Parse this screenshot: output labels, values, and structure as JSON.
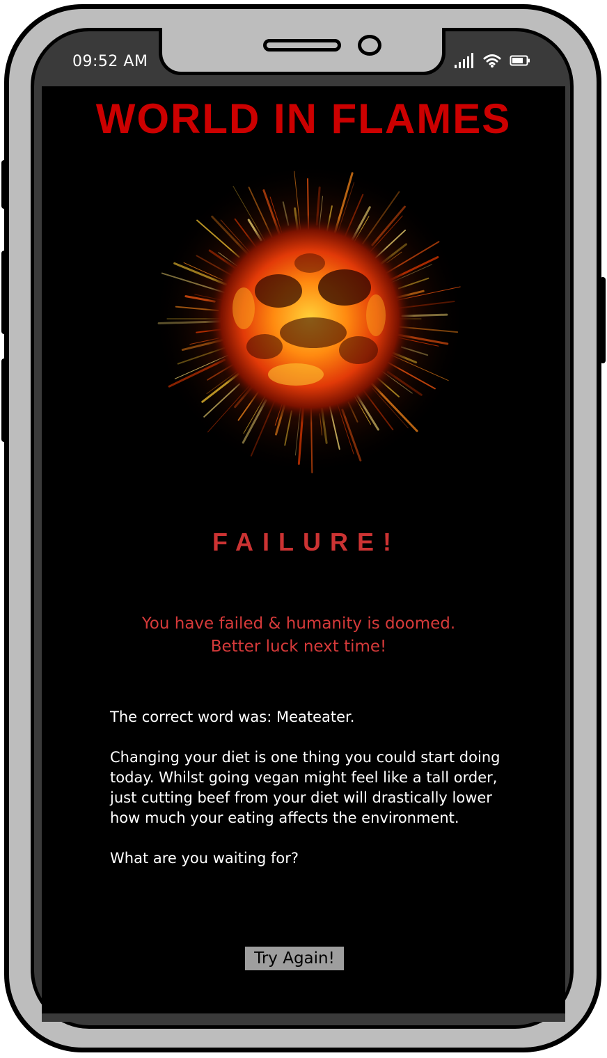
{
  "status_bar": {
    "time": "09:52 AM"
  },
  "app": {
    "title": "WORLD IN FLAMES",
    "result_heading": "FAILURE!",
    "doom_line1": "You have failed & humanity is doomed.",
    "doom_line2": "Better luck next time!",
    "correct_word_text": "The correct word was: Meateater.",
    "advice_text": "Changing your diet is one thing you could start doing today. Whilst going vegan might feel like a tall order, just cutting  beef from your diet will drastically lower how much your eating affects the environment.",
    "question_text": "What are you waiting for?",
    "try_again_label": "Try Again!"
  },
  "icons": {
    "explosion": "explosion-icon",
    "signal": "signal-icon",
    "wifi": "wifi-icon",
    "battery": "battery-icon"
  },
  "colors": {
    "title": "#cc0000",
    "failure": "#cc3333",
    "doom_text": "#d63a3a",
    "screen_bg": "#000000",
    "phone_frame": "#bdbdbd",
    "button_bg": "#9e9e9e"
  }
}
